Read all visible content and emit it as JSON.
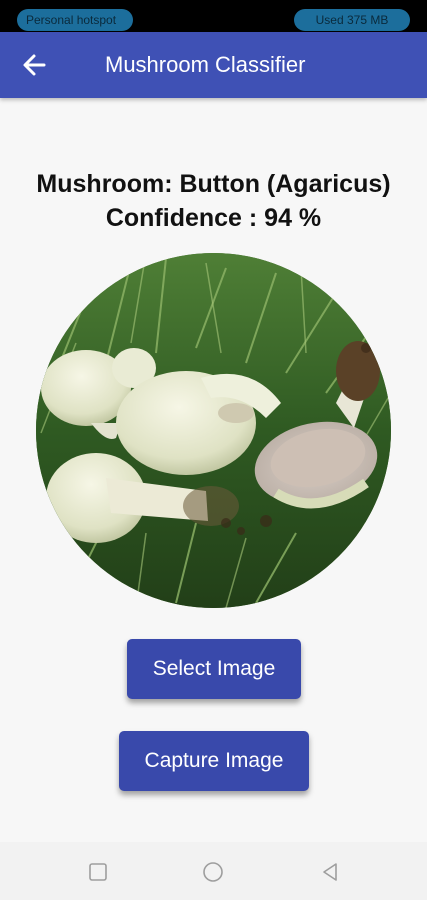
{
  "status_bar": {
    "hotspot_label": "Personal hotspot",
    "data_usage": "Used  375 MB"
  },
  "app_bar": {
    "title": "Mushroom Classifier",
    "back_icon": "arrow-back-icon",
    "color": "#3f51b5"
  },
  "result": {
    "mushroom_label": "Mushroom: ",
    "mushroom_value": "Button (Agaricus)",
    "confidence_label": "Confidence : ",
    "confidence_value": "94 %"
  },
  "photo": {
    "subject": "mushroom-photo"
  },
  "actions": {
    "select_label": "Select Image",
    "capture_label": "Capture Image",
    "button_color": "#3949ab"
  },
  "nav_bar": {
    "icons": [
      "recents-icon",
      "home-icon",
      "back-icon"
    ]
  }
}
